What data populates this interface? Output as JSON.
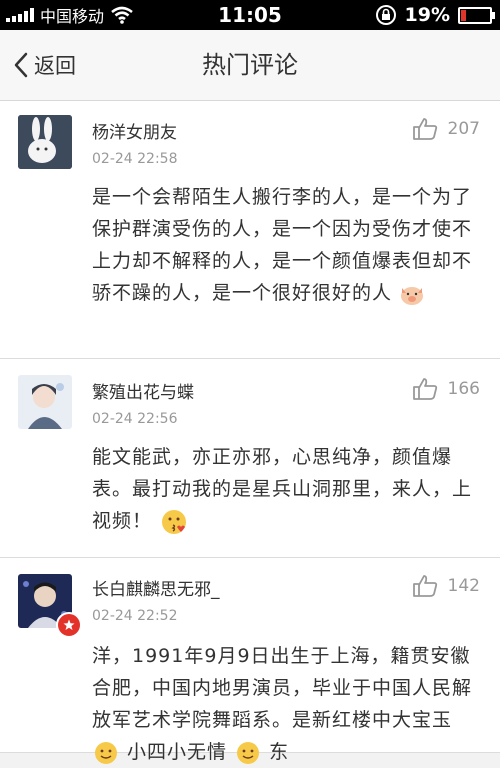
{
  "status_bar": {
    "carrier": "中国移动",
    "time": "11:05",
    "battery": "19%",
    "battery_level": 0.19
  },
  "nav": {
    "back_label": "返回",
    "title": "热门评论"
  },
  "comments": [
    {
      "username": "杨洋女朋友",
      "time": "02-24 22:58",
      "likes": "207",
      "text": "是一个会帮陌生人搬行李的人，是一个为了保护群演受伤的人，是一个因为受伤才使不上力却不解释的人，是一个颜值爆表但却不骄不躁的人，是一个很好很好的人",
      "emoji": "pig-face-emoji"
    },
    {
      "username": "繁殖出花与蝶",
      "time": "02-24 22:56",
      "likes": "166",
      "text": "能文能武，亦正亦邪，心思纯净，颜值爆表。最打动我的是星兵山洞那里，来人，上视频！",
      "emoji": "kiss-face-emoji"
    },
    {
      "username": "长白麒麟思无邪_",
      "time": "02-24 22:52",
      "likes": "142",
      "text": "洋，1991年9月9日出生于上海，籍贯安徽合肥，中国内地男演员，毕业于中国人民解放军艺术学院舞蹈系。是新红楼中大宝玉",
      "text_tail": "小四小无情",
      "tail_end": "东"
    }
  ]
}
